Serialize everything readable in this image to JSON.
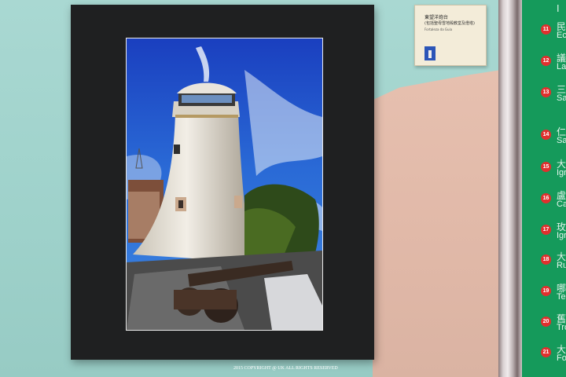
{
  "placard": {
    "title": "東望洋炮台",
    "subtitle": "(包括聖母雪地殿教堂及燈塔)",
    "latin": "Fortaleza da Guia"
  },
  "panel": {
    "top_cn": "I",
    "items": [
      {
        "num": "11",
        "cn": "民",
        "en": "Ec"
      },
      {
        "num": "12",
        "cn": "議",
        "en": "La"
      },
      {
        "num": "13",
        "cn": "三",
        "en": "Sa"
      },
      {
        "num": "14",
        "cn": "仁",
        "en": "Sa"
      },
      {
        "num": "15",
        "cn": "大",
        "en": "Igr"
      },
      {
        "num": "16",
        "cn": "盧",
        "en": "Ca"
      },
      {
        "num": "17",
        "cn": "玫",
        "en": "Igre"
      },
      {
        "num": "18",
        "cn": "大",
        "en": "Rui"
      },
      {
        "num": "19",
        "cn": "哪",
        "en": "Tem"
      },
      {
        "num": "20",
        "cn": "舊",
        "en": "Tro"
      },
      {
        "num": "21",
        "cn": "大",
        "en": "For"
      }
    ]
  },
  "copyright": "2015 COPYRIGHT @ UK ALL RIGHTS RESERVED",
  "colors": {
    "mat": "#1f2021",
    "panel_green": "#159a5b",
    "badge_red": "#e0302e",
    "sky": "#1f49d1"
  }
}
